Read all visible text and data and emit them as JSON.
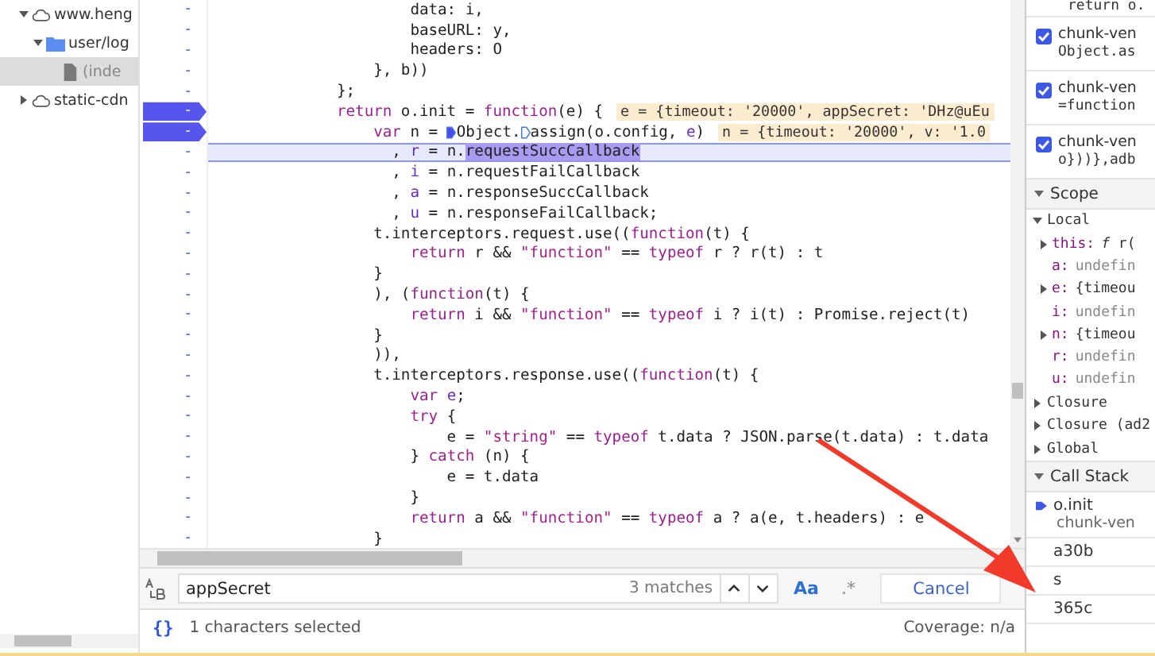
{
  "file_tree": [
    {
      "label": "www.heng",
      "kind": "domain",
      "expanded": true,
      "selected": false,
      "children": [
        {
          "label": "user/log",
          "kind": "folder",
          "expanded": true,
          "selected": false,
          "children": [
            {
              "label": "(inde",
              "kind": "file",
              "selected": true
            }
          ]
        }
      ]
    },
    {
      "label": "static-cdn",
      "kind": "domain",
      "expanded": false,
      "selected": false
    }
  ],
  "code_lines": [
    {
      "gutter": "-",
      "breakpoint": false,
      "highlighted": false,
      "tokens": [
        {
          "text": "        data: i,",
          "kind": "plain"
        }
      ]
    },
    {
      "gutter": "-",
      "breakpoint": false,
      "highlighted": false,
      "tokens": [
        {
          "text": "        baseURL: y,",
          "kind": "plain"
        }
      ]
    },
    {
      "gutter": "-",
      "breakpoint": false,
      "highlighted": false,
      "tokens": [
        {
          "text": "        headers: O",
          "kind": "plain"
        }
      ]
    },
    {
      "gutter": "-",
      "breakpoint": false,
      "highlighted": false,
      "tokens": [
        {
          "text": "    }, b))",
          "kind": "plain"
        }
      ]
    },
    {
      "gutter": "-",
      "breakpoint": false,
      "highlighted": false,
      "tokens": [
        {
          "text": "};",
          "kind": "plain"
        }
      ]
    },
    {
      "gutter": "-",
      "breakpoint": true,
      "highlighted": false,
      "tokens": [
        {
          "text": "return",
          "kind": "keyword"
        },
        {
          "text": " o.init = ",
          "kind": "plain"
        },
        {
          "text": "function",
          "kind": "keyword"
        },
        {
          "text": "(e) {",
          "kind": "plain"
        }
      ],
      "inline_value": "e = {timeout: '20000', appSecret: 'DHz@uEu"
    },
    {
      "gutter": "-",
      "breakpoint": true,
      "highlighted": false,
      "tokens": [
        {
          "text": "    var",
          "kind": "keyword"
        },
        {
          "text": " n = ",
          "kind": "plain"
        },
        {
          "kind": "breakpoint_on"
        },
        {
          "text": "Object.",
          "kind": "plain"
        },
        {
          "kind": "breakpoint_off"
        },
        {
          "text": "assign(o.config, ",
          "kind": "plain"
        },
        {
          "text": "e",
          "kind": "declaration"
        },
        {
          "text": ")",
          "kind": "plain"
        }
      ],
      "inline_value": "n = {timeout: '20000', v: '1.0"
    },
    {
      "gutter": "-",
      "breakpoint": false,
      "highlighted": true,
      "tokens": [
        {
          "text": "      , ",
          "kind": "plain"
        },
        {
          "text": "r",
          "kind": "declaration"
        },
        {
          "text": " = n.",
          "kind": "plain"
        },
        {
          "text": "requestSuccCallback",
          "kind": "selection"
        }
      ]
    },
    {
      "gutter": "-",
      "breakpoint": false,
      "highlighted": false,
      "tokens": [
        {
          "text": "      , ",
          "kind": "plain"
        },
        {
          "text": "i",
          "kind": "declaration"
        },
        {
          "text": " = n.requestFailCallback",
          "kind": "plain"
        }
      ]
    },
    {
      "gutter": "-",
      "breakpoint": false,
      "highlighted": false,
      "tokens": [
        {
          "text": "      , ",
          "kind": "plain"
        },
        {
          "text": "a",
          "kind": "declaration"
        },
        {
          "text": " = n.responseSuccCallback",
          "kind": "plain"
        }
      ]
    },
    {
      "gutter": "-",
      "breakpoint": false,
      "highlighted": false,
      "tokens": [
        {
          "text": "      , ",
          "kind": "plain"
        },
        {
          "text": "u",
          "kind": "declaration"
        },
        {
          "text": " = n.responseFailCallback;",
          "kind": "plain"
        }
      ]
    },
    {
      "gutter": "-",
      "breakpoint": false,
      "highlighted": false,
      "tokens": [
        {
          "text": "    t.interceptors.request.use((",
          "kind": "plain"
        },
        {
          "text": "function",
          "kind": "keyword"
        },
        {
          "text": "(t) {",
          "kind": "plain"
        }
      ]
    },
    {
      "gutter": "-",
      "breakpoint": false,
      "highlighted": false,
      "tokens": [
        {
          "text": "        return",
          "kind": "keyword"
        },
        {
          "text": " r && ",
          "kind": "plain"
        },
        {
          "text": "\"function\"",
          "kind": "string"
        },
        {
          "text": " == ",
          "kind": "plain"
        },
        {
          "text": "typeof",
          "kind": "keyword"
        },
        {
          "text": " r ? r(t) : t",
          "kind": "plain"
        }
      ]
    },
    {
      "gutter": "-",
      "breakpoint": false,
      "highlighted": false,
      "tokens": [
        {
          "text": "    }",
          "kind": "plain"
        }
      ]
    },
    {
      "gutter": "-",
      "breakpoint": false,
      "highlighted": false,
      "tokens": [
        {
          "text": "    ), (",
          "kind": "plain"
        },
        {
          "text": "function",
          "kind": "keyword"
        },
        {
          "text": "(t) {",
          "kind": "plain"
        }
      ]
    },
    {
      "gutter": "-",
      "breakpoint": false,
      "highlighted": false,
      "tokens": [
        {
          "text": "        return",
          "kind": "keyword"
        },
        {
          "text": " i && ",
          "kind": "plain"
        },
        {
          "text": "\"function\"",
          "kind": "string"
        },
        {
          "text": " == ",
          "kind": "plain"
        },
        {
          "text": "typeof",
          "kind": "keyword"
        },
        {
          "text": " i ? i(t) : Promise.reject(t)",
          "kind": "plain"
        }
      ]
    },
    {
      "gutter": "-",
      "breakpoint": false,
      "highlighted": false,
      "tokens": [
        {
          "text": "    }",
          "kind": "plain"
        }
      ]
    },
    {
      "gutter": "-",
      "breakpoint": false,
      "highlighted": false,
      "tokens": [
        {
          "text": "    )),",
          "kind": "plain"
        }
      ]
    },
    {
      "gutter": "-",
      "breakpoint": false,
      "highlighted": false,
      "tokens": [
        {
          "text": "    t.interceptors.response.use((",
          "kind": "plain"
        },
        {
          "text": "function",
          "kind": "keyword"
        },
        {
          "text": "(t) {",
          "kind": "plain"
        }
      ]
    },
    {
      "gutter": "-",
      "breakpoint": false,
      "highlighted": false,
      "tokens": [
        {
          "text": "        var",
          "kind": "keyword"
        },
        {
          "text": " e",
          "kind": "declaration"
        },
        {
          "text": ";",
          "kind": "plain"
        }
      ]
    },
    {
      "gutter": "-",
      "breakpoint": false,
      "highlighted": false,
      "tokens": [
        {
          "text": "        try",
          "kind": "keyword"
        },
        {
          "text": " {",
          "kind": "plain"
        }
      ]
    },
    {
      "gutter": "-",
      "breakpoint": false,
      "highlighted": false,
      "tokens": [
        {
          "text": "            e = ",
          "kind": "plain"
        },
        {
          "text": "\"string\"",
          "kind": "string"
        },
        {
          "text": " == ",
          "kind": "plain"
        },
        {
          "text": "typeof",
          "kind": "keyword"
        },
        {
          "text": " t.data ? JSON.parse(t.data) : t.data",
          "kind": "plain"
        }
      ]
    },
    {
      "gutter": "-",
      "breakpoint": false,
      "highlighted": false,
      "tokens": [
        {
          "text": "        } ",
          "kind": "plain"
        },
        {
          "text": "catch",
          "kind": "keyword"
        },
        {
          "text": " (n) {",
          "kind": "plain"
        }
      ]
    },
    {
      "gutter": "-",
      "breakpoint": false,
      "highlighted": false,
      "tokens": [
        {
          "text": "            e = t.data",
          "kind": "plain"
        }
      ]
    },
    {
      "gutter": "-",
      "breakpoint": false,
      "highlighted": false,
      "tokens": [
        {
          "text": "        }",
          "kind": "plain"
        }
      ]
    },
    {
      "gutter": "-",
      "breakpoint": false,
      "highlighted": false,
      "tokens": [
        {
          "text": "        return",
          "kind": "keyword"
        },
        {
          "text": " a && ",
          "kind": "plain"
        },
        {
          "text": "\"function\"",
          "kind": "string"
        },
        {
          "text": " == ",
          "kind": "plain"
        },
        {
          "text": "typeof",
          "kind": "keyword"
        },
        {
          "text": " a ? a(e, t.headers) : e",
          "kind": "plain"
        }
      ]
    },
    {
      "gutter": "-",
      "breakpoint": false,
      "highlighted": false,
      "tokens": [
        {
          "text": "    }",
          "kind": "plain"
        }
      ]
    }
  ],
  "search": {
    "value": "appSecret",
    "match_count": "3 matches",
    "match_case_label": "Aa",
    "match_case": true,
    "regex_label": ".*",
    "regex": false,
    "cancel": "Cancel"
  },
  "status_bar": {
    "pretty_print": "{}",
    "selection": "1 characters selected",
    "coverage": "Coverage: n/a"
  },
  "debugger": {
    "top_line": "return o.",
    "breakpoints": [
      {
        "file": "chunk-ven",
        "code": "Object.as",
        "checked": true
      },
      {
        "file": "chunk-ven",
        "code": "=function",
        "checked": true
      },
      {
        "file": "chunk-ven",
        "code": "o}))},adb",
        "checked": true
      }
    ],
    "scope": {
      "title": "Scope",
      "expanded": true,
      "local": {
        "title": "Local",
        "expanded": true,
        "vars": [
          {
            "name": "this:",
            "value": "*f* r(",
            "kind": "object",
            "expandable": true
          },
          {
            "name": "a:",
            "value": "undefin",
            "kind": "undefined",
            "expandable": false
          },
          {
            "name": "e:",
            "value": "{timeou",
            "kind": "object",
            "expandable": true
          },
          {
            "name": "i:",
            "value": "undefin",
            "kind": "undefined",
            "expandable": false
          },
          {
            "name": "n:",
            "value": "{timeou",
            "kind": "object",
            "expandable": true
          },
          {
            "name": "r:",
            "value": "undefin",
            "kind": "undefined",
            "expandable": false
          },
          {
            "name": "u:",
            "value": "undefin",
            "kind": "undefined",
            "expandable": false
          }
        ]
      },
      "others": [
        {
          "label": "Closure",
          "expanded": false
        },
        {
          "label": "Closure (ad2",
          "expanded": false
        },
        {
          "label": "Global",
          "expanded": false
        }
      ]
    },
    "call_stack": {
      "title": "Call Stack",
      "expanded": true,
      "frames": [
        {
          "name": "o.init",
          "location": "chunk-ven",
          "current": true
        },
        {
          "name": "a30b",
          "current": false
        },
        {
          "name": "s",
          "current": false
        },
        {
          "name": "365c",
          "current": false
        }
      ]
    }
  }
}
